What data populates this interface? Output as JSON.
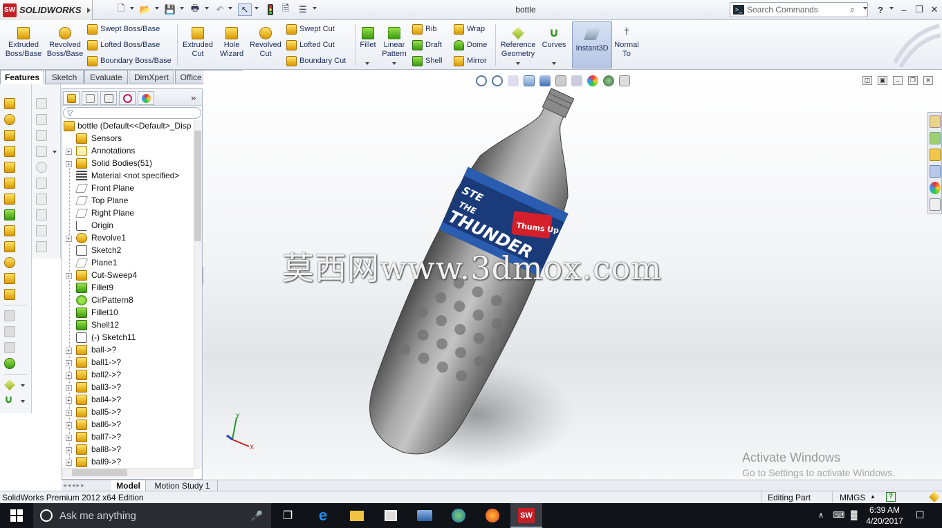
{
  "titlebar": {
    "app_logo_text": "SOLIDWORKS",
    "app_logo_badge": "SW",
    "document_title": "bottle",
    "search_placeholder": "Search Commands",
    "help_label": "?"
  },
  "command_manager": {
    "large_buttons": [
      {
        "label": "Extruded Boss/Base"
      },
      {
        "label": "Revolved Boss/Base"
      },
      {
        "label": "Extruded Cut"
      },
      {
        "label": "Hole Wizard"
      },
      {
        "label": "Revolved Cut"
      },
      {
        "label": "Fillet"
      },
      {
        "label": "Linear Pattern"
      },
      {
        "label": "Reference Geometry"
      },
      {
        "label": "Curves"
      },
      {
        "label": "Instant3D"
      },
      {
        "label": "Normal To"
      }
    ],
    "small_buttons": [
      {
        "label": "Swept Boss/Base"
      },
      {
        "label": "Lofted Boss/Base"
      },
      {
        "label": "Boundary Boss/Base"
      },
      {
        "label": "Swept Cut"
      },
      {
        "label": "Lofted Cut"
      },
      {
        "label": "Boundary Cut"
      },
      {
        "label": "Rib"
      },
      {
        "label": "Draft"
      },
      {
        "label": "Shell"
      },
      {
        "label": "Wrap"
      },
      {
        "label": "Dome"
      },
      {
        "label": "Mirror"
      }
    ]
  },
  "tabs": [
    {
      "label": "Features",
      "active": true
    },
    {
      "label": "Sketch",
      "active": false
    },
    {
      "label": "Evaluate",
      "active": false
    },
    {
      "label": "DimXpert",
      "active": false
    },
    {
      "label": "Office Products",
      "active": false
    }
  ],
  "feature_tree": {
    "root": "bottle  (Default<<Default>_Disp",
    "items": [
      {
        "label": "Sensors",
        "expander": "",
        "icon": "sensors-icon"
      },
      {
        "label": "Annotations",
        "expander": "+",
        "icon": "annotations-icon"
      },
      {
        "label": "Solid Bodies(51)",
        "expander": "+",
        "icon": "solid-bodies-icon"
      },
      {
        "label": "Material <not specified>",
        "expander": "",
        "icon": "material-icon"
      },
      {
        "label": "Front Plane",
        "expander": "",
        "icon": "plane-icon"
      },
      {
        "label": "Top Plane",
        "expander": "",
        "icon": "plane-icon"
      },
      {
        "label": "Right Plane",
        "expander": "",
        "icon": "plane-icon"
      },
      {
        "label": "Origin",
        "expander": "",
        "icon": "origin-icon"
      },
      {
        "label": "Revolve1",
        "expander": "+",
        "icon": "revolve-icon"
      },
      {
        "label": "Sketch2",
        "expander": "",
        "icon": "sketch-icon"
      },
      {
        "label": "Plane1",
        "expander": "",
        "icon": "plane-icon"
      },
      {
        "label": "Cut-Sweep4",
        "expander": "+",
        "icon": "cut-sweep-icon"
      },
      {
        "label": "Fillet9",
        "expander": "",
        "icon": "fillet-icon"
      },
      {
        "label": "CirPattern8",
        "expander": "",
        "icon": "circular-pattern-icon"
      },
      {
        "label": "Fillet10",
        "expander": "",
        "icon": "fillet-icon"
      },
      {
        "label": "Shell12",
        "expander": "",
        "icon": "shell-icon"
      },
      {
        "label": "(-) Sketch11",
        "expander": "",
        "icon": "sketch-icon"
      },
      {
        "label": "ball->?",
        "expander": "+",
        "icon": "part-icon"
      },
      {
        "label": "ball1->?",
        "expander": "+",
        "icon": "part-icon"
      },
      {
        "label": "ball2->?",
        "expander": "+",
        "icon": "part-icon"
      },
      {
        "label": "ball3->?",
        "expander": "+",
        "icon": "part-icon"
      },
      {
        "label": "ball4->?",
        "expander": "+",
        "icon": "part-icon"
      },
      {
        "label": "ball5->?",
        "expander": "+",
        "icon": "part-icon"
      },
      {
        "label": "ball6->?",
        "expander": "+",
        "icon": "part-icon"
      },
      {
        "label": "ball7->?",
        "expander": "+",
        "icon": "part-icon"
      },
      {
        "label": "ball8->?",
        "expander": "+",
        "icon": "part-icon"
      },
      {
        "label": "ball9->?",
        "expander": "+",
        "icon": "part-icon"
      }
    ]
  },
  "bottom_tabs": [
    {
      "label": "Model",
      "active": true
    },
    {
      "label": "Motion Study 1",
      "active": false
    }
  ],
  "viewport": {
    "watermark": "莫西网www.3dmox.com",
    "label_text_top": "STE",
    "label_text_mid": "THE",
    "label_text_big": "THUNDER",
    "label_logo": "Thums Up",
    "axis_x": "X",
    "axis_y": "Y",
    "activate_title": "Activate Windows",
    "activate_sub": "Go to Settings to activate Windows."
  },
  "statusbar": {
    "edition": "SolidWorks Premium 2012 x64 Edition",
    "mode": "Editing Part",
    "units": "MMGS",
    "units_arrow": "▲",
    "help_badge": "?"
  },
  "taskbar": {
    "cortana_placeholder": "Ask me anything",
    "time": "6:39 AM",
    "date": "4/20/2017"
  },
  "colors": {
    "brand_red": "#c62026",
    "accent_blue": "#1b2b5a",
    "taskbar": "#101318"
  }
}
